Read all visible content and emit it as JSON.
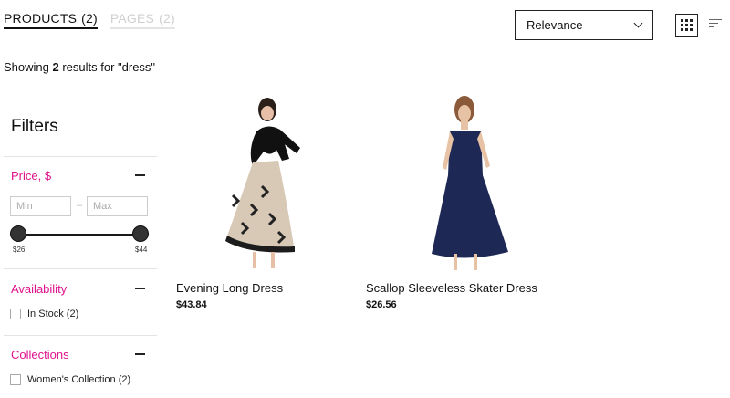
{
  "tabs": [
    {
      "label": "PRODUCTS",
      "count": "(2)",
      "active": true
    },
    {
      "label": "PAGES",
      "count": "(2)",
      "active": false
    }
  ],
  "sort": {
    "selected": "Relevance"
  },
  "view_toggle": {
    "grid_icon": "grid-icon",
    "list_icon": "list-icon"
  },
  "results": {
    "prefix": "Showing ",
    "count": "2",
    "middle": " results for ",
    "query": "\"dress\""
  },
  "filters": {
    "title": "Filters",
    "price": {
      "title": "Price, $",
      "min_placeholder": "Min",
      "separator": "–",
      "max_placeholder": "Max",
      "range_min_label": "$26",
      "range_max_label": "$44"
    },
    "availability": {
      "title": "Availability",
      "options": [
        {
          "label": "In Stock (2)",
          "checked": false
        }
      ]
    },
    "collections": {
      "title": "Collections",
      "options": [
        {
          "label": "Women's Collection (2)",
          "checked": false
        }
      ]
    }
  },
  "products": [
    {
      "title": "Evening Long Dress",
      "price": "$43.84"
    },
    {
      "title": "Scallop Sleeveless Skater Dress",
      "price": "$26.56"
    }
  ],
  "colors": {
    "accent": "#e0138c",
    "text": "#111111",
    "border": "#222222",
    "muted": "#cfcfcf"
  }
}
